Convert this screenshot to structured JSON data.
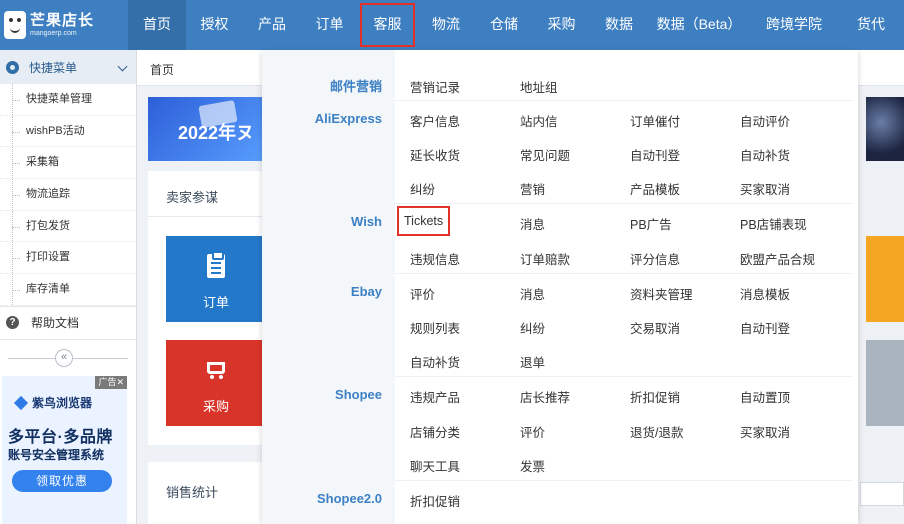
{
  "logo": {
    "title": "芒果店长",
    "subtitle": "mangoerp.com"
  },
  "nav": [
    "首页",
    "授权",
    "产品",
    "订单",
    "客服",
    "物流",
    "仓储",
    "采购",
    "数据",
    "数据（Beta）",
    "跨境学院",
    "货代"
  ],
  "sidebar": {
    "quick_menu": "快捷菜单",
    "items": [
      "快捷菜单管理",
      "wishPB活动",
      "采集箱",
      "物流追踪",
      "打包发货",
      "打印设置",
      "库存清单"
    ],
    "help": "帮助文档",
    "collapse_symbol": "«"
  },
  "ad": {
    "tag": "广告",
    "close": "✕",
    "brand": "紫鸟浏览器",
    "line1": "多平台·多品牌",
    "line2": "账号安全管理系统",
    "button": "领取优惠"
  },
  "breadcrumb": "首页",
  "banner_text": "2022年ヌ",
  "seller_panel": {
    "title": "卖家参谋",
    "tile_order": "订单",
    "tile_purchase": "采购"
  },
  "sales_panel": {
    "title": "销售统计"
  },
  "dropdown": {
    "categories": [
      "邮件营销",
      "AliExpress",
      "Wish",
      "Ebay",
      "Shopee",
      "Shopee2.0"
    ],
    "email": [
      "营销记录",
      "地址组"
    ],
    "aliexpress": [
      "客户信息",
      "站内信",
      "订单催付",
      "自动评价",
      "延长收货",
      "常见问题",
      "自动刊登",
      "自动补货",
      "纠纷",
      "营销",
      "产品模板",
      "买家取消"
    ],
    "wish": [
      "Tickets",
      "消息",
      "PB广告",
      "PB店铺表现",
      "违规信息",
      "订单赔款",
      "评分信息",
      "欧盟产品合规"
    ],
    "ebay": [
      "评价",
      "消息",
      "资料夹管理",
      "消息模板",
      "规则列表",
      "纠纷",
      "交易取消",
      "自动刊登",
      "自动补货",
      "退单"
    ],
    "shopee": [
      "违规产品",
      "店长推荐",
      "折扣促销",
      "自动置顶",
      "店铺分类",
      "评价",
      "退货/退款",
      "买家取消",
      "聊天工具",
      "发票"
    ],
    "shopee2": [
      "折扣促销"
    ]
  },
  "colors": {
    "topbar": "#3d7fc1",
    "accent": "#3d80c4",
    "highlight": "#e0322b"
  }
}
